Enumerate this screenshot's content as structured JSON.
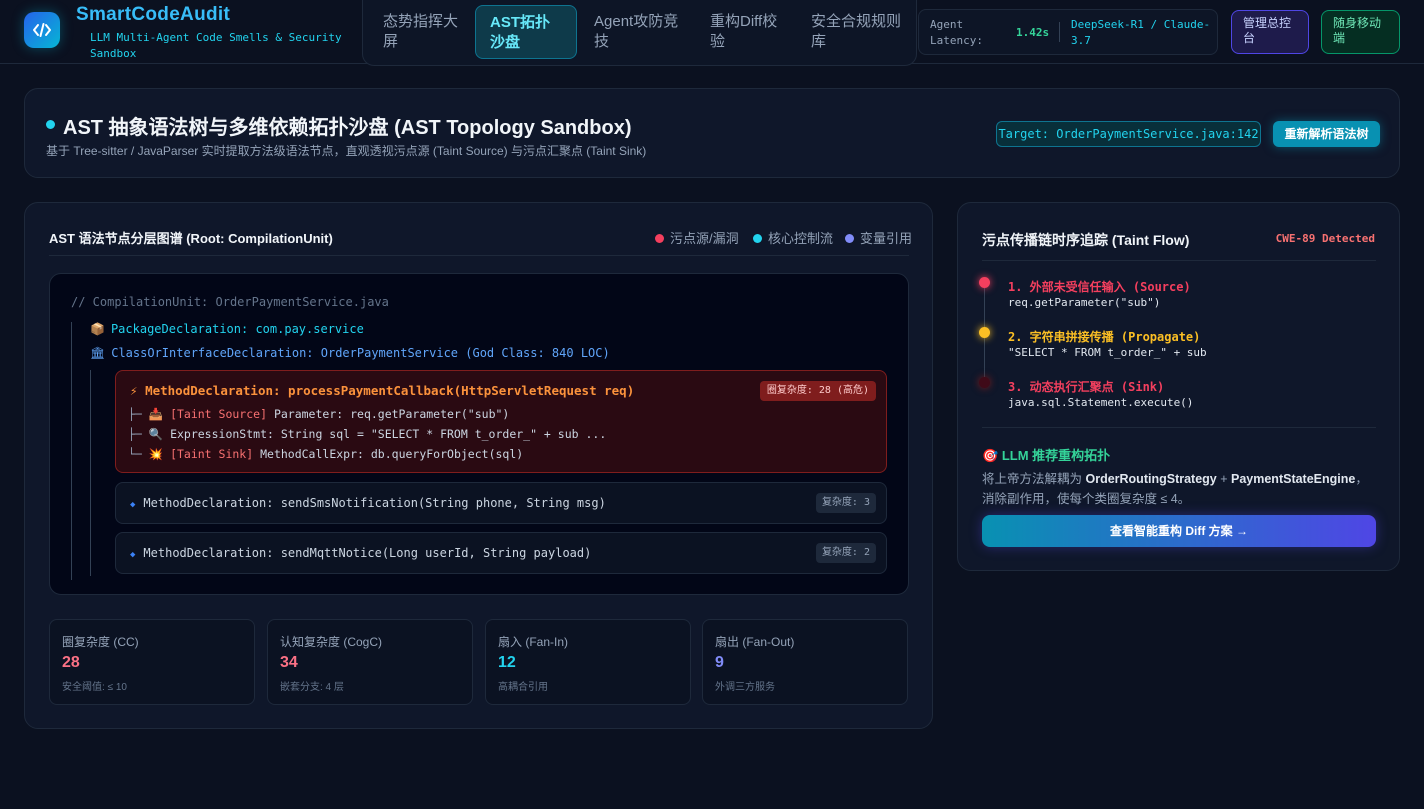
{
  "app": {
    "title": "SmartCodeAudit",
    "subtitle": "LLM Multi-Agent Code Smells & Security Sandbox"
  },
  "nav": {
    "items": [
      {
        "label": "态势指挥大屏"
      },
      {
        "label": "AST拓扑沙盘",
        "active": true
      },
      {
        "label": "Agent攻防竞技"
      },
      {
        "label": "重构Diff校验"
      },
      {
        "label": "安全合规规则库"
      }
    ]
  },
  "status": {
    "latency_label": "Agent Latency:",
    "latency_value": "1.42s",
    "models": "DeepSeek-R1 / Claude-3.7"
  },
  "actions": {
    "admin": "管理总控台",
    "mobile": "随身移动端"
  },
  "hero": {
    "title": "AST 抽象语法树与多维依赖拓扑沙盘 (AST Topology Sandbox)",
    "subtitle": "基于 Tree-sitter / JavaParser 实时提取方法级语法节点，直观透视污点源 (Taint Source) 与污点汇聚点 (Taint Sink)",
    "target": "Target: OrderPaymentService.java:142",
    "reparse": "重新解析语法树"
  },
  "ast": {
    "title": "AST 语法节点分层图谱 (Root: CompilationUnit)",
    "legend": [
      {
        "label": "污点源/漏洞",
        "color": "#f43f5e"
      },
      {
        "label": "核心控制流",
        "color": "#22d3ee"
      },
      {
        "label": "变量引用",
        "color": "#818cf8"
      }
    ],
    "comment": "// CompilationUnit: OrderPaymentService.java",
    "package_node": "PackageDeclaration: com.pay.service",
    "class_node": "ClassOrInterfaceDeclaration: OrderPaymentService (God Class: 840 LOC)",
    "hot_method": {
      "title": "MethodDeclaration: processPaymentCallback(HttpServletRequest req)",
      "badge": "圈复杂度: 28 (高危)",
      "lines": [
        {
          "prefix": "├─",
          "icon": "📥",
          "tag": "[Taint Source]",
          "text": "Parameter: req.getParameter(\"sub\")"
        },
        {
          "prefix": "├─",
          "icon": "🔍",
          "tag": "",
          "text": "ExpressionStmt: String sql = \"SELECT * FROM t_order_\" + sub ..."
        },
        {
          "prefix": "└─",
          "icon": "💥",
          "tag": "[Taint Sink]",
          "text": "MethodCallExpr: db.queryForObject(sql)"
        }
      ]
    },
    "methods": [
      {
        "text": "MethodDeclaration: sendSmsNotification(String phone, String msg)",
        "badge": "复杂度: 3"
      },
      {
        "text": "MethodDeclaration: sendMqttNotice(Long userId, String payload)",
        "badge": "复杂度: 2"
      }
    ]
  },
  "metrics": [
    {
      "label": "圈复杂度 (CC)",
      "value": "28",
      "note": "安全阈值: ≤ 10",
      "color": "#fb7185"
    },
    {
      "label": "认知复杂度 (CogC)",
      "value": "34",
      "note": "嵌套分支: 4 层",
      "color": "#fb7185"
    },
    {
      "label": "扇入 (Fan-In)",
      "value": "12",
      "note": "高耦合引用",
      "color": "#22d3ee"
    },
    {
      "label": "扇出 (Fan-Out)",
      "value": "9",
      "note": "外调三方服务",
      "color": "#818cf8"
    }
  ],
  "taint": {
    "title": "污点传播链时序追踪 (Taint Flow)",
    "cwe": "CWE-89 Detected",
    "steps": [
      {
        "label": "1. 外部未受信任输入 (Source)",
        "code": "req.getParameter(\"sub\")",
        "color": "#f43f5e"
      },
      {
        "label": "2. 字符串拼接传播 (Propagate)",
        "code": "\"SELECT * FROM t_order_\" + sub",
        "color": "#fbbf24"
      },
      {
        "label": "3. 动态执行汇聚点 (Sink)",
        "code": "java.sql.Statement.execute()",
        "color": "#f43f5e"
      }
    ],
    "llm_title": "LLM 推荐重构拓扑",
    "llm_desc_pre": "将上帝方法解耦为 ",
    "llm_strategy_a": "OrderRoutingStrategy",
    "llm_plus": " + ",
    "llm_strategy_b": "PaymentStateEngine",
    "llm_desc_post": "，消除副作用，使每个类圈复杂度 ≤ 4。",
    "diff_button": "查看智能重构 Diff 方案 →"
  }
}
